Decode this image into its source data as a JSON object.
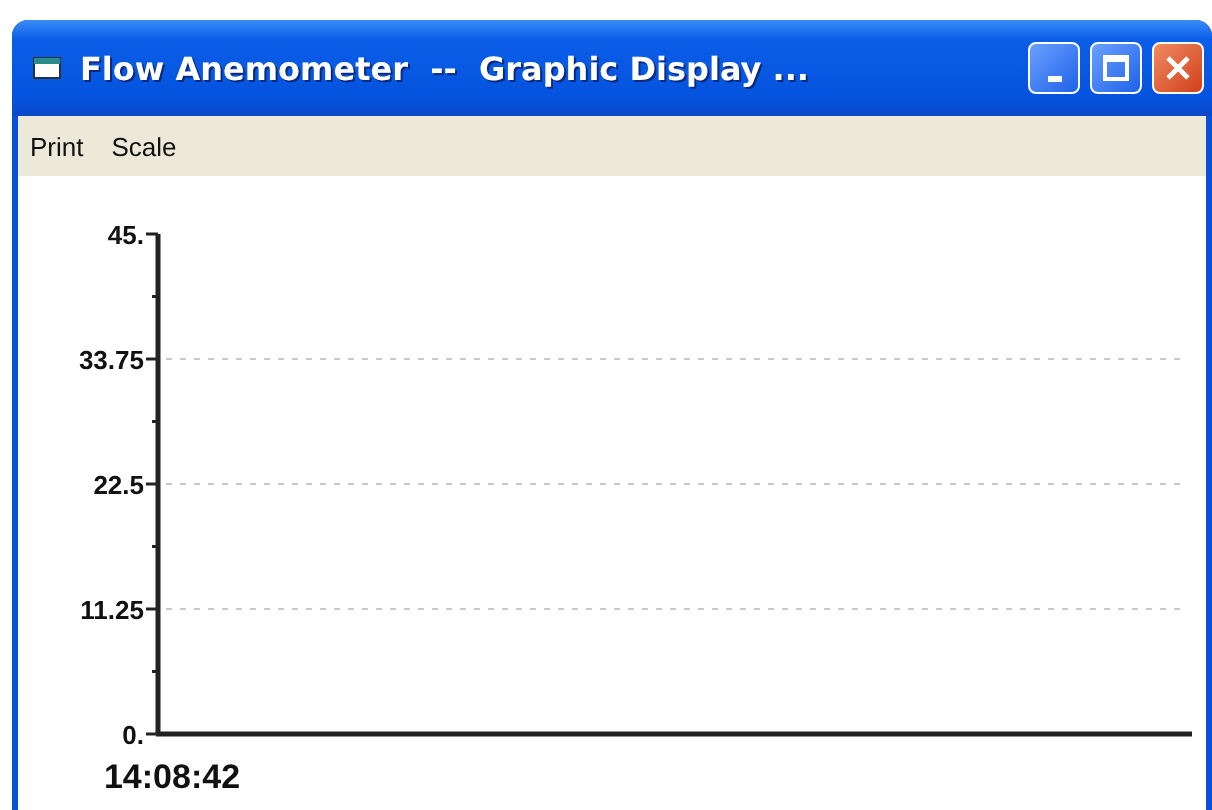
{
  "window": {
    "title": "Flow Anemometer  --  Graphic Display ..."
  },
  "menu": [
    {
      "label": "Print"
    },
    {
      "label": "Scale"
    }
  ],
  "chart_data": {
    "type": "line",
    "grid": true,
    "categories": [
      "14:08:42"
    ],
    "ylim": [
      0,
      45
    ],
    "yticks": [
      {
        "value": 0,
        "label": "0."
      },
      {
        "value": 11.25,
        "label": "11.25"
      },
      {
        "value": 22.5,
        "label": "22.5"
      },
      {
        "value": 33.75,
        "label": "33.75"
      },
      {
        "value": 45,
        "label": "45."
      }
    ]
  }
}
